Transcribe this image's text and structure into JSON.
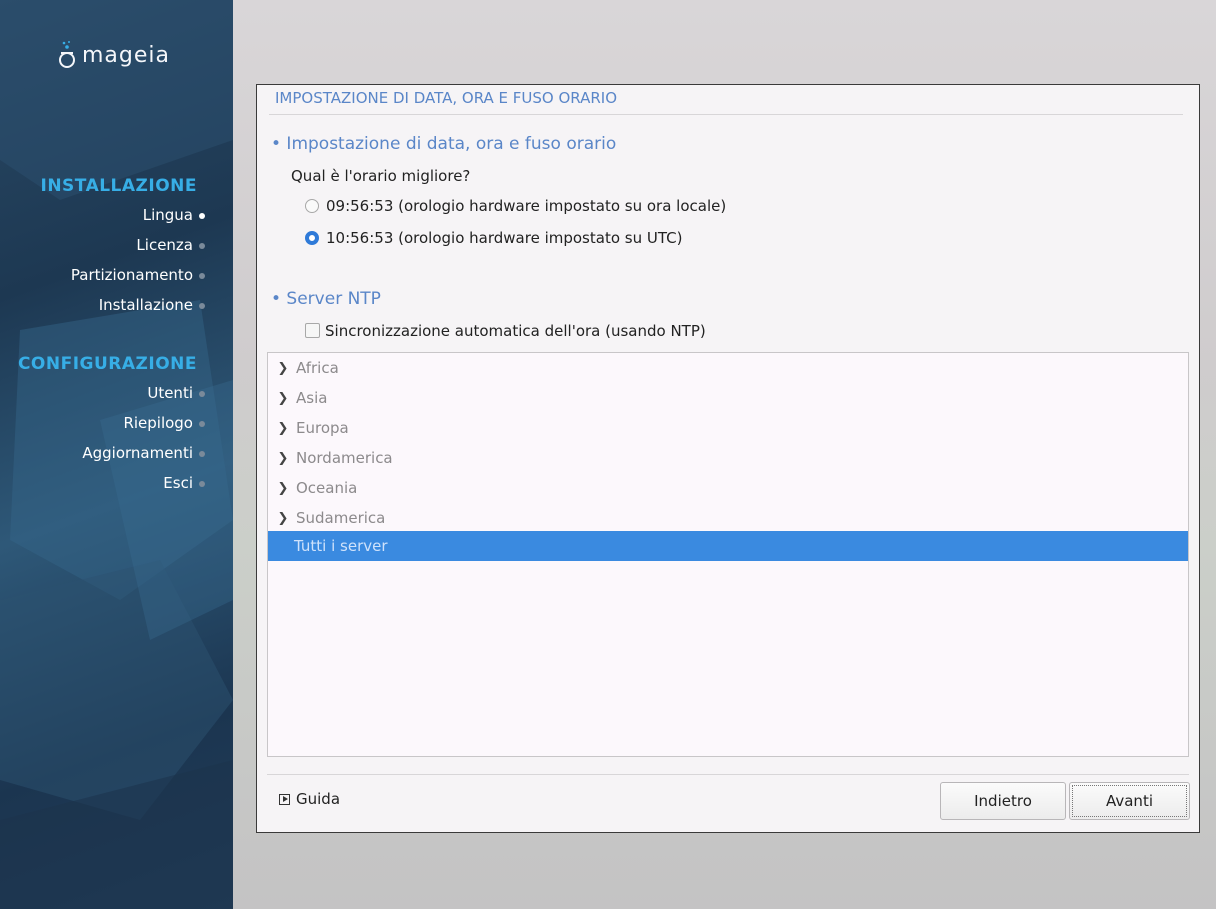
{
  "sidebar": {
    "logo_text": "mageia",
    "sections": [
      {
        "title": "INSTALLAZIONE",
        "steps": [
          {
            "label": "Lingua",
            "done": true
          },
          {
            "label": "Licenza",
            "done": false
          },
          {
            "label": "Partizionamento",
            "done": false
          },
          {
            "label": "Installazione",
            "done": false
          }
        ]
      },
      {
        "title": "CONFIGURAZIONE",
        "steps": [
          {
            "label": "Utenti",
            "done": false
          },
          {
            "label": "Riepilogo",
            "done": false
          },
          {
            "label": "Aggiornamenti",
            "done": false
          },
          {
            "label": "Esci",
            "done": false
          }
        ]
      }
    ]
  },
  "dialog": {
    "title": "IMPOSTAZIONE DI DATA, ORA E FUSO ORARIO",
    "section1_heading": "• Impostazione di data, ora e fuso orario",
    "question": "Qual è l'orario migliore?",
    "radio_options": [
      {
        "label": "09:56:53 (orologio hardware impostato su ora locale)",
        "checked": false
      },
      {
        "label": "10:56:53 (orologio hardware impostato su UTC)",
        "checked": true
      }
    ],
    "section2_heading": "• Server NTP",
    "ntp_checkbox": {
      "label": "Sincronizzazione automatica dell'ora (usando NTP)",
      "checked": false
    },
    "server_tree": [
      {
        "label": "Africa",
        "expandable": true,
        "selected": false
      },
      {
        "label": "Asia",
        "expandable": true,
        "selected": false
      },
      {
        "label": "Europa",
        "expandable": true,
        "selected": false
      },
      {
        "label": "Nordamerica",
        "expandable": true,
        "selected": false
      },
      {
        "label": "Oceania",
        "expandable": true,
        "selected": false
      },
      {
        "label": "Sudamerica",
        "expandable": true,
        "selected": false
      },
      {
        "label": "Tutti i server",
        "expandable": false,
        "selected": true
      }
    ],
    "help_label": "Guida",
    "back_label": "Indietro",
    "next_label": "Avanti"
  },
  "colors": {
    "accent_blue": "#5a86c8",
    "section_title": "#37aee6",
    "selection": "#3a8ae0"
  }
}
